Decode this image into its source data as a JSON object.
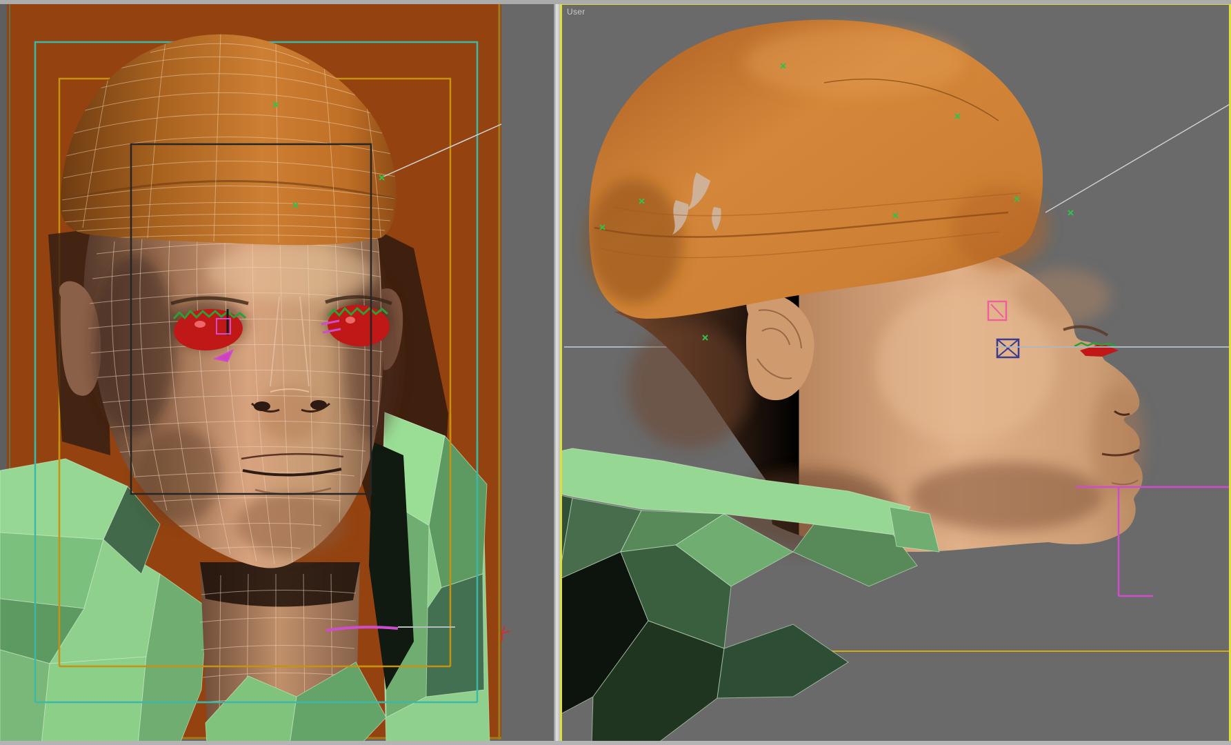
{
  "right_viewport": {
    "label": "User"
  },
  "colors": {
    "viewport_bg": "#6a6a6a",
    "left_bg": "#686868",
    "backdrop": "#944310",
    "active_border": "#dede3c",
    "gizmo_teal": "#3cb8a8",
    "gizmo_yellow": "#c79210",
    "selection_black": "#262626",
    "eye_red": "#c01717",
    "lash_green": "#2f9e35",
    "marker_green": "#35c04a",
    "helper_pink": "#ef5f9b",
    "helper_navy": "#3b3b8f",
    "magenta": "#cf4ccf",
    "guide_line": "#aab8c2",
    "scene_yellow_line": "#cfae12",
    "hat_orange": "#cd7f33",
    "skin": "#d8a37e",
    "shirt_green": "#93d693"
  },
  "icons": {
    "plane_helper": "pink-square-with-diagonal",
    "crossed_box_helper": "navy-box-with-x",
    "axis_tripod": "rgb-axis-lines",
    "vertex_marker": "green-x-tick"
  }
}
